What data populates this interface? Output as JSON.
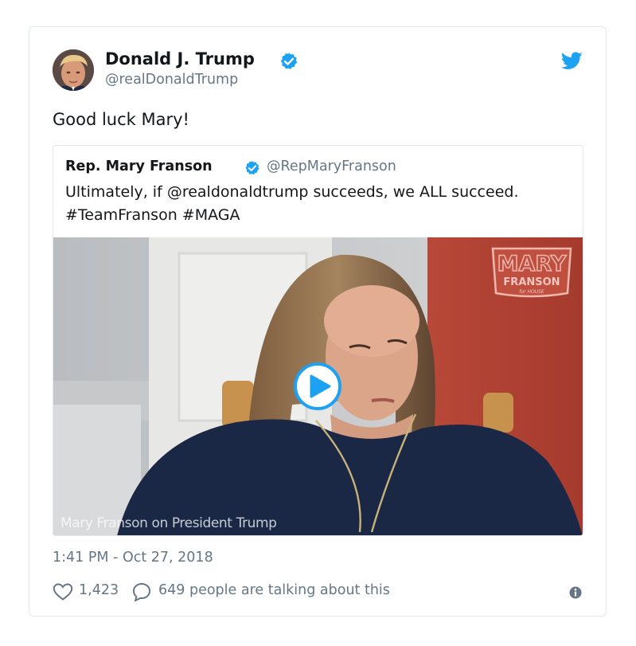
{
  "tweet": {
    "display_name": "Donald J. Trump",
    "screen_name": "@realDonaldTrump",
    "text": "Good luck Mary!",
    "timestamp": "1:41 PM - Oct 27, 2018",
    "avatar_icon": "profile-photo",
    "verified_icon": "verified-badge-icon",
    "brand_icon": "twitter-bird-icon",
    "accent_color": "#1da1f2"
  },
  "quoted_tweet": {
    "display_name": "Rep. Mary Franson",
    "screen_name": "@RepMaryFranson",
    "text_line_1": "Ultimately, if @realdonaldtrump succeeds, we ALL succeed.",
    "text_line_2": "#TeamFranson #MAGA",
    "video": {
      "caption": "Mary Franson on President Trump",
      "play_icon": "play-icon",
      "watermark": {
        "line_1": "MARY",
        "line_2": "FRANSON",
        "line_3": "for HOUSE"
      }
    }
  },
  "footer": {
    "like_count": "1,423",
    "reply_text": "649 people are talking about this",
    "like_icon": "heart-icon",
    "reply_icon": "speech-bubble-icon",
    "info_icon": "info-icon"
  }
}
